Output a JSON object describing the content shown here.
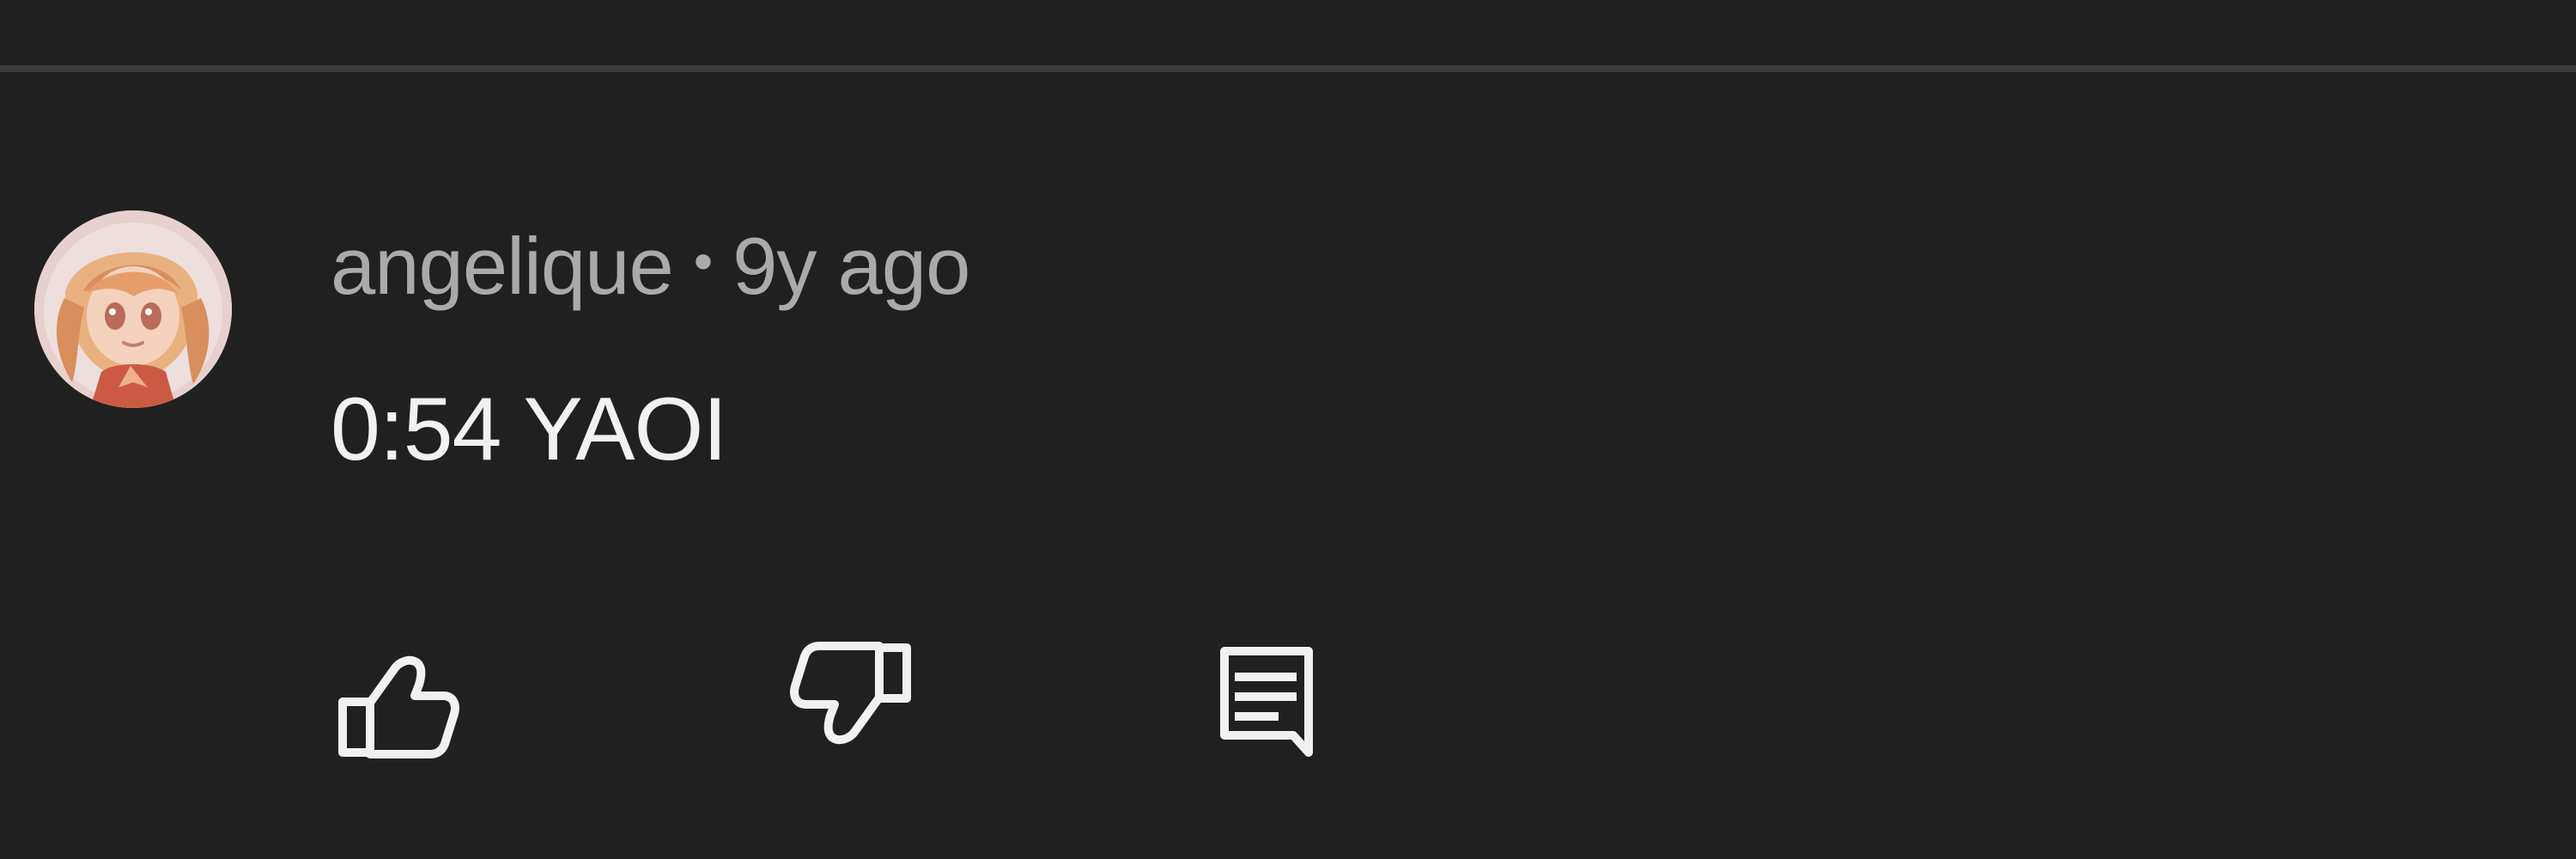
{
  "comment": {
    "author": "angelique",
    "separator": "•",
    "time_ago": "9y ago",
    "text": "0:54 YAOI"
  },
  "actions": {
    "like_icon": "thumbs-up-icon",
    "dislike_icon": "thumbs-down-icon",
    "reply_icon": "reply-comment-icon"
  },
  "colors": {
    "background": "#202020",
    "divider": "#3a3a3a",
    "meta_text": "#aaaaaa",
    "body_text": "#f1f1f1",
    "icon": "#f1f1f1"
  }
}
